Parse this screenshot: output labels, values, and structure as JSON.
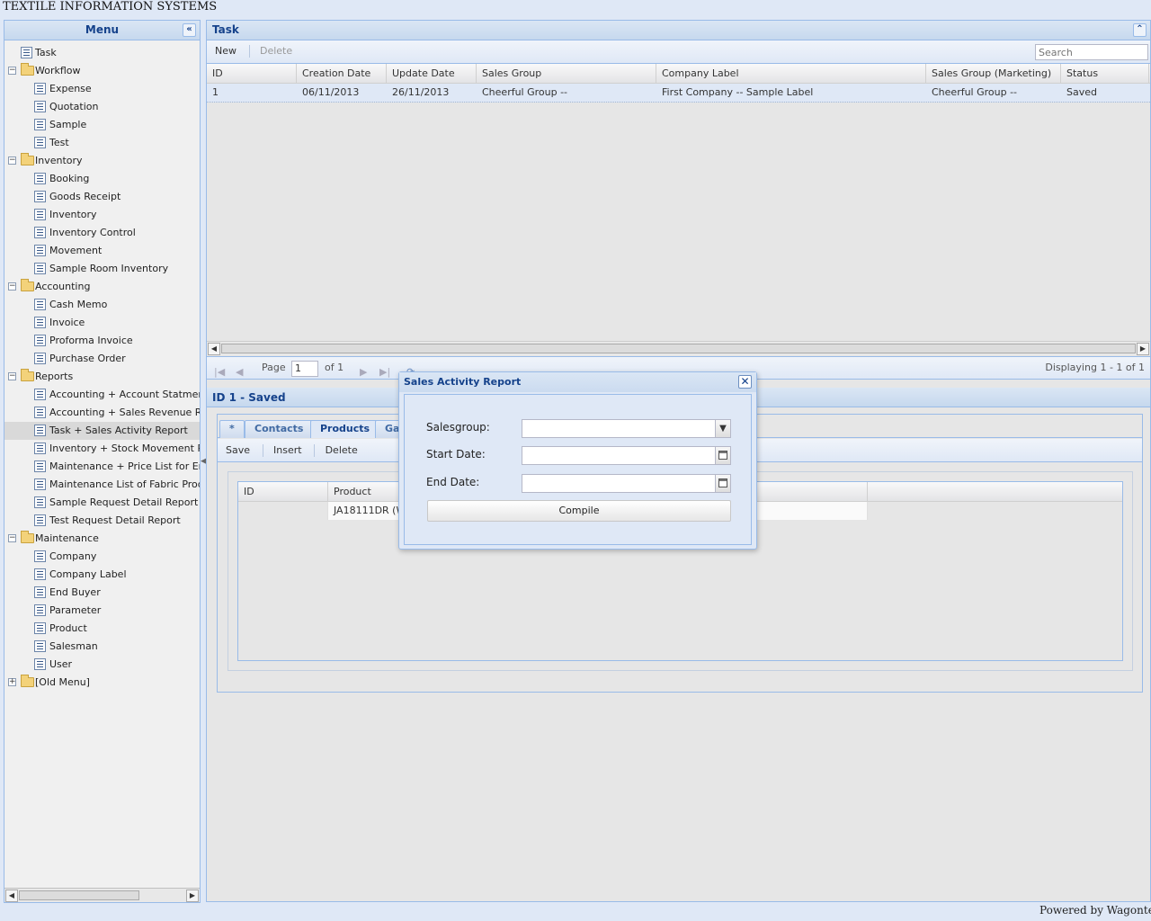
{
  "app": {
    "title": "TEXTILE INFORMATION SYSTEMS",
    "footer": "Powered by Wagontec"
  },
  "sidebar": {
    "title": "Menu",
    "collapse_glyph": "«",
    "items": [
      {
        "label": "Task",
        "type": "leaf",
        "level": 0
      },
      {
        "label": "Workflow",
        "type": "folder",
        "level": 0,
        "expanded": true
      },
      {
        "label": "Expense",
        "type": "leaf",
        "level": 1
      },
      {
        "label": "Quotation",
        "type": "leaf",
        "level": 1
      },
      {
        "label": "Sample",
        "type": "leaf",
        "level": 1
      },
      {
        "label": "Test",
        "type": "leaf",
        "level": 1
      },
      {
        "label": "Inventory",
        "type": "folder",
        "level": 0,
        "expanded": true
      },
      {
        "label": "Booking",
        "type": "leaf",
        "level": 1
      },
      {
        "label": "Goods Receipt",
        "type": "leaf",
        "level": 1
      },
      {
        "label": "Inventory",
        "type": "leaf",
        "level": 1
      },
      {
        "label": "Inventory Control",
        "type": "leaf",
        "level": 1
      },
      {
        "label": "Movement",
        "type": "leaf",
        "level": 1
      },
      {
        "label": "Sample Room Inventory",
        "type": "leaf",
        "level": 1
      },
      {
        "label": "Accounting",
        "type": "folder",
        "level": 0,
        "expanded": true
      },
      {
        "label": "Cash Memo",
        "type": "leaf",
        "level": 1
      },
      {
        "label": "Invoice",
        "type": "leaf",
        "level": 1
      },
      {
        "label": "Proforma Invoice",
        "type": "leaf",
        "level": 1
      },
      {
        "label": "Purchase Order",
        "type": "leaf",
        "level": 1
      },
      {
        "label": "Reports",
        "type": "folder",
        "level": 0,
        "expanded": true
      },
      {
        "label": "Accounting + Account Statment",
        "type": "leaf",
        "level": 1
      },
      {
        "label": "Accounting + Sales Revenue Report",
        "type": "leaf",
        "level": 1
      },
      {
        "label": "Task + Sales Activity Report",
        "type": "leaf",
        "level": 1,
        "selected": true
      },
      {
        "label": "Inventory + Stock Movement Report",
        "type": "leaf",
        "level": 1
      },
      {
        "label": "Maintenance + Price List for End Buyer",
        "type": "leaf",
        "level": 1
      },
      {
        "label": "Maintenance List of Fabric Products",
        "type": "leaf",
        "level": 1
      },
      {
        "label": "Sample Request Detail Report",
        "type": "leaf",
        "level": 1
      },
      {
        "label": "Test Request Detail Report",
        "type": "leaf",
        "level": 1
      },
      {
        "label": "Maintenance",
        "type": "folder",
        "level": 0,
        "expanded": true
      },
      {
        "label": "Company",
        "type": "leaf",
        "level": 1
      },
      {
        "label": "Company Label",
        "type": "leaf",
        "level": 1
      },
      {
        "label": "End Buyer",
        "type": "leaf",
        "level": 1
      },
      {
        "label": "Parameter",
        "type": "leaf",
        "level": 1
      },
      {
        "label": "Product",
        "type": "leaf",
        "level": 1
      },
      {
        "label": "Salesman",
        "type": "leaf",
        "level": 1
      },
      {
        "label": "User",
        "type": "leaf",
        "level": 1
      },
      {
        "label": "[Old Menu]",
        "type": "folder",
        "level": 0,
        "expanded": false
      }
    ]
  },
  "main": {
    "title": "Task",
    "toolbar": {
      "new_label": "New",
      "delete_label": "Delete"
    },
    "search": {
      "placeholder": "Search"
    },
    "grid": {
      "columns": [
        "ID",
        "Creation Date",
        "Update Date",
        "Sales Group",
        "Company Label",
        "Sales Group (Marketing)",
        "Status"
      ],
      "rows": [
        [
          "1",
          "06/11/2013",
          "26/11/2013",
          "Cheerful Group --",
          "First Company -- Sample Label",
          "Cheerful Group --",
          "Saved"
        ]
      ]
    },
    "paging": {
      "page_label": "Page",
      "page_value": "1",
      "of_label": "of 1",
      "displaying": "Displaying 1 - 1 of 1"
    }
  },
  "detail": {
    "title": "ID 1 - Saved",
    "tabs": [
      "*",
      "Contacts",
      "Products",
      "Ga"
    ],
    "active_tab": "Products",
    "toolbar": {
      "save_label": "Save",
      "insert_label": "Insert",
      "delete_label": "Delete"
    },
    "grid": {
      "columns": [
        "ID",
        "Product"
      ],
      "rows": [
        [
          "",
          "JA18111DR (W"
        ]
      ]
    }
  },
  "modal": {
    "title": "Sales Activity Report",
    "close_glyph": "✕",
    "fields": {
      "salesgroup": {
        "label": "Salesgroup:",
        "value": ""
      },
      "start_date": {
        "label": "Start Date:",
        "value": ""
      },
      "end_date": {
        "label": "End Date:",
        "value": ""
      }
    },
    "compile_label": "Compile"
  },
  "icons": {
    "folder": "folder-icon",
    "leaf": "document-icon",
    "dropdown": "chevron-down-icon",
    "date": "calendar-icon",
    "close": "close-icon"
  },
  "colors": {
    "header_text": "#15428b",
    "panel_border": "#99bbe8",
    "selection": "#dfe8f6"
  }
}
